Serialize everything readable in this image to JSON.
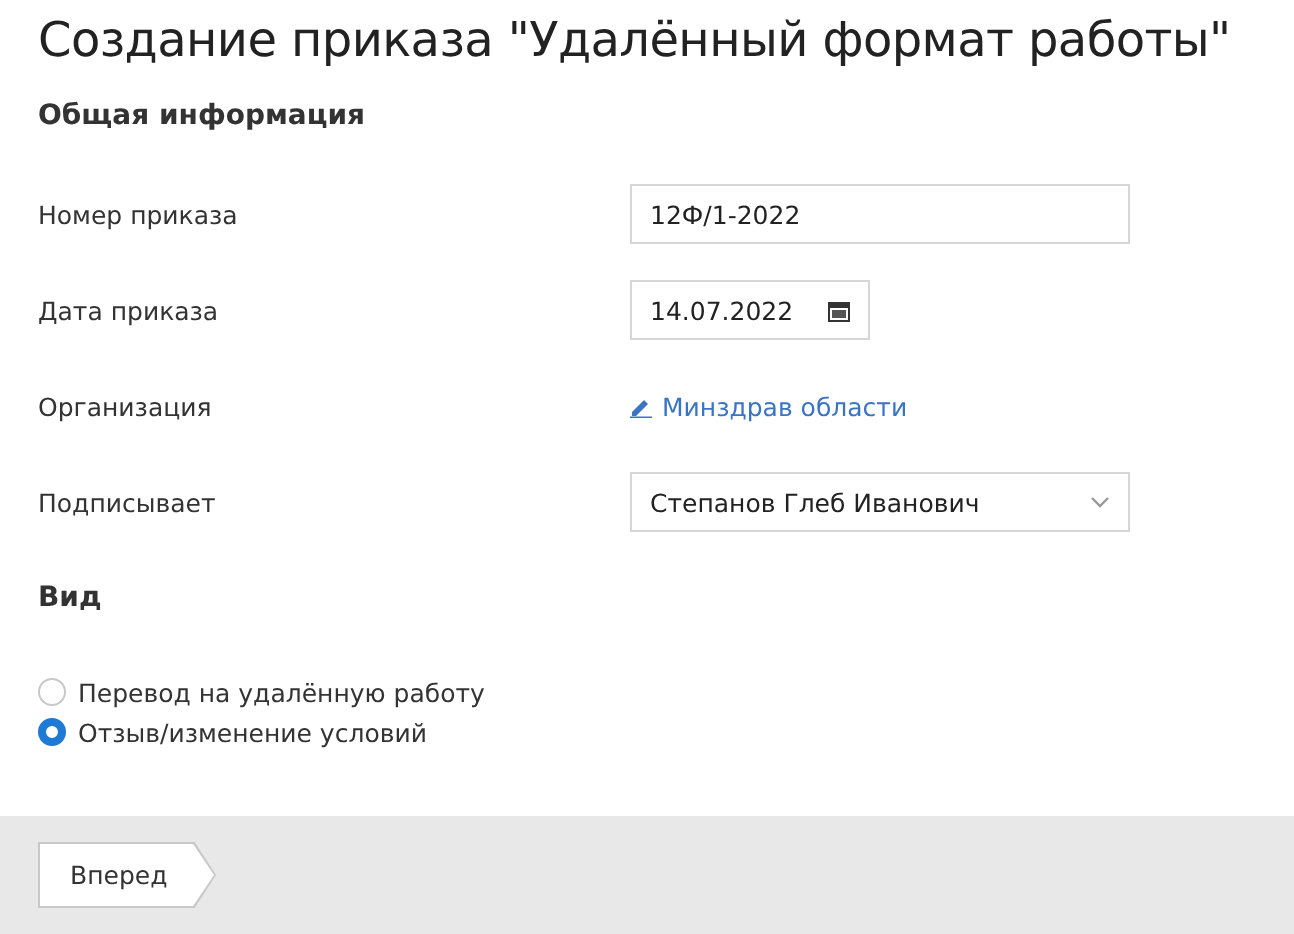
{
  "title": "Создание приказа \"Удалённый формат работы\"",
  "section": "Общая информация",
  "fields": [
    {
      "label": "Номер приказа",
      "kind": "text",
      "value": "12Ф/1-2022"
    },
    {
      "label": "Дата приказа",
      "kind": "date",
      "value": "14.07.2022"
    },
    {
      "label": "Организация",
      "kind": "link",
      "value": "Минздрав области"
    },
    {
      "label": "Подписывает",
      "kind": "select",
      "value": "Степанов Глеб Иванович"
    }
  ],
  "type_group": {
    "label": "Вид",
    "options": [
      {
        "label": "Перевод на удалённую работу",
        "selected": false
      },
      {
        "label": "Отзыв/изменение условий",
        "selected": true
      }
    ]
  },
  "footer": {
    "button": "Вперед"
  }
}
